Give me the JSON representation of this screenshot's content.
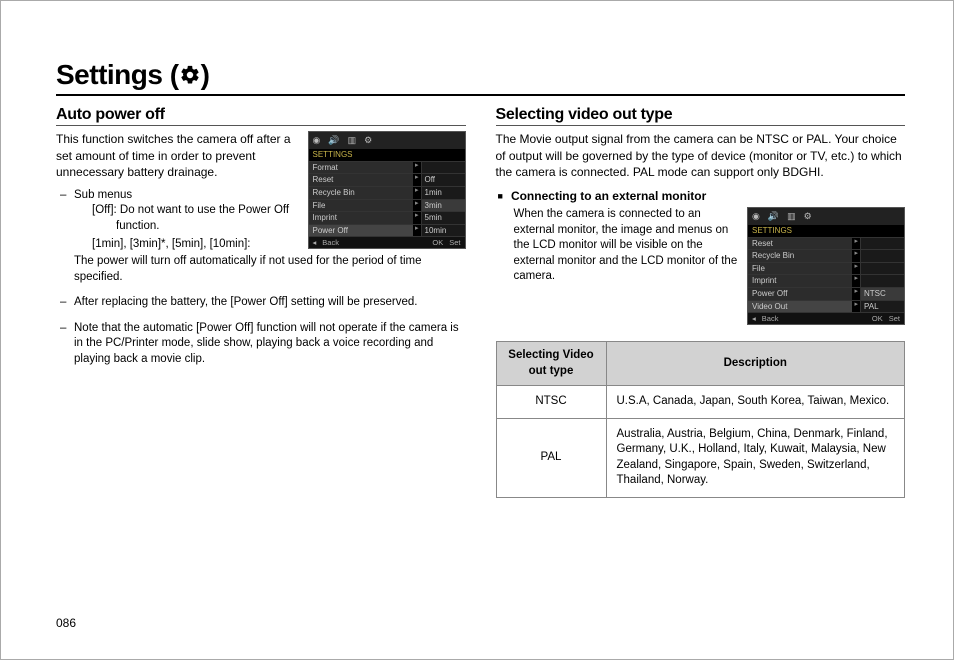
{
  "page_title": "Settings (",
  "page_title_suffix": ")",
  "page_number": "086",
  "left": {
    "heading": "Auto power off",
    "intro": "This function switches the camera off after a set amount of time in order to prevent unnecessary battery drainage.",
    "sub_label": "Sub menus",
    "off_line": "[Off]: Do not want to use the Power Off function.",
    "times_line": "[1min], [3min]*, [5min], [10min]:",
    "times_desc": "The power will turn off automatically if not used for the period of time specified.",
    "bullet2": "After replacing the battery, the [Power Off] setting will be preserved.",
    "bullet3": "Note that the automatic [Power Off] function will not operate if the camera is in the PC/Printer mode, slide show, playing back a voice recording and playing back a movie clip.",
    "ss": {
      "header": "SETTINGS",
      "rows": [
        {
          "l": "Format",
          "r": ""
        },
        {
          "l": "Reset",
          "r": "Off"
        },
        {
          "l": "Recycle Bin",
          "r": "1min"
        },
        {
          "l": "File",
          "r": "3min"
        },
        {
          "l": "Imprint",
          "r": "5min"
        },
        {
          "l": "Power Off",
          "r": "10min"
        }
      ],
      "back": "Back",
      "ok": "OK",
      "set": "Set"
    }
  },
  "right": {
    "heading": "Selecting video out type",
    "intro": "The Movie output signal from the camera can be NTSC or PAL. Your choice of output will be governed by the type of device (monitor or TV, etc.) to which the camera is connected. PAL mode can support only BDGHI.",
    "subhead": "Connecting to an external monitor",
    "subtext": "When the camera is connected to an external monitor, the image and menus on the LCD monitor will be visible on the external monitor and the LCD monitor of the camera.",
    "ss": {
      "header": "SETTINGS",
      "rows": [
        {
          "l": "Reset",
          "r": ""
        },
        {
          "l": "Recycle Bin",
          "r": ""
        },
        {
          "l": "File",
          "r": ""
        },
        {
          "l": "Imprint",
          "r": ""
        },
        {
          "l": "Power Off",
          "r": "NTSC"
        },
        {
          "l": "Video Out",
          "r": "PAL"
        }
      ],
      "back": "Back",
      "ok": "OK",
      "set": "Set"
    },
    "table": {
      "th1": "Selecting Video out type",
      "th2": "Description",
      "r1t": "NTSC",
      "r1d": "U.S.A, Canada, Japan, South Korea, Taiwan, Mexico.",
      "r2t": "PAL",
      "r2d": "Australia, Austria, Belgium, China, Denmark, Finland, Germany, U.K., Holland, Italy, Kuwait, Malaysia, New Zealand, Singapore, Spain, Sweden, Switzerland, Thailand, Norway."
    }
  }
}
